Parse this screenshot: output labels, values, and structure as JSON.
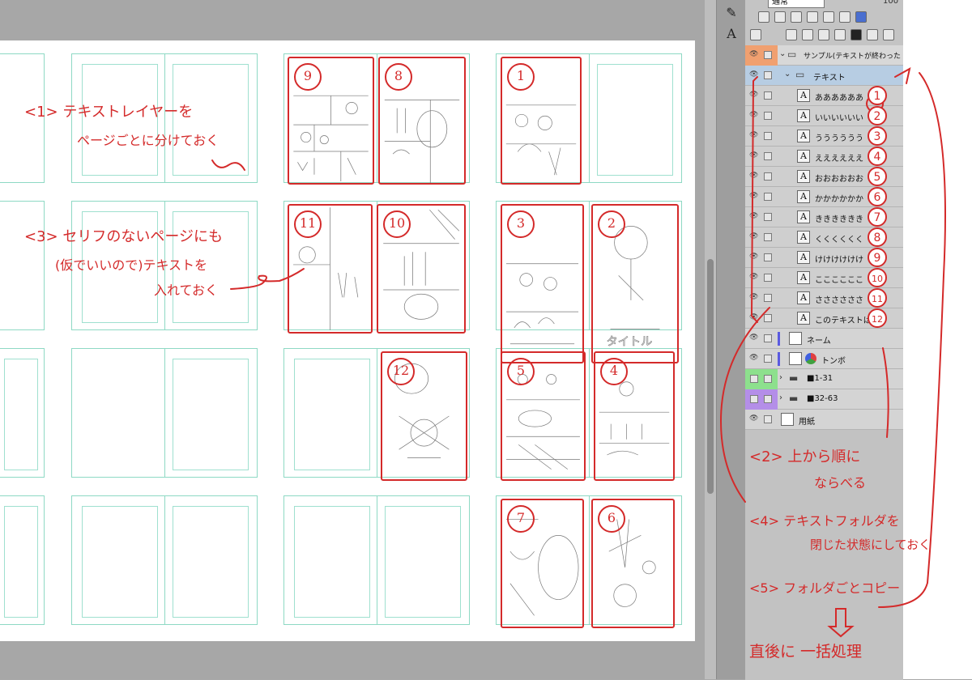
{
  "layer_panel": {
    "blend_mode": "通常",
    "opacity": "100",
    "layers": [
      {
        "name": "サンプル(テキストが終わったら消し",
        "kind": "folder",
        "color": "#f0a070"
      },
      {
        "name": "テキスト",
        "kind": "folder",
        "selected": true
      },
      {
        "name": "ああああああ",
        "kind": "text",
        "marker": "1"
      },
      {
        "name": "いいいいいい",
        "kind": "text",
        "marker": "2"
      },
      {
        "name": "うううううう",
        "kind": "text",
        "marker": "3"
      },
      {
        "name": "ええええええ",
        "kind": "text",
        "marker": "4"
      },
      {
        "name": "おおおおおお",
        "kind": "text",
        "marker": "5"
      },
      {
        "name": "かかかかかか",
        "kind": "text",
        "marker": "6"
      },
      {
        "name": "きききききき",
        "kind": "text",
        "marker": "7"
      },
      {
        "name": "くくくくくく",
        "kind": "text",
        "marker": "8"
      },
      {
        "name": "けけけけけけ",
        "kind": "text",
        "marker": "9"
      },
      {
        "name": "ここここここ",
        "kind": "text",
        "marker": "10"
      },
      {
        "name": "ささささささ",
        "kind": "text",
        "marker": "11"
      },
      {
        "name": "このテキストは デ",
        "kind": "text",
        "marker": "12"
      },
      {
        "name": "ネーム",
        "kind": "layer"
      },
      {
        "name": "トンボ",
        "kind": "layer"
      },
      {
        "name": "■1-31",
        "kind": "folder",
        "color": "#8de08d"
      },
      {
        "name": "■32-63",
        "kind": "folder",
        "color": "#b48ee8"
      },
      {
        "name": "用紙",
        "kind": "paper"
      }
    ]
  },
  "canvas": {
    "page_numbers": [
      "9",
      "8",
      "1",
      "11",
      "10",
      "3",
      "2",
      "12",
      "5",
      "4",
      "7",
      "6"
    ]
  },
  "notes": {
    "n1_a": "<1> テキストレイヤーを",
    "n1_b": "ページごとに分けておく",
    "n3_a": "<3> セリフのないページにも",
    "n3_b": "(仮でいいので)テキストを",
    "n3_c": "入れておく",
    "n2_a": "<2> 上から順に",
    "n2_b": "ならべる",
    "n4_a": "<4> テキストフォルダを",
    "n4_b": "閉じた状態にしておく",
    "n5": "<5> フォルダごとコピー",
    "n6": "直後に 一括処理"
  },
  "colors": {
    "annotation": "#d42a2a",
    "guide": "#8ed9c4",
    "selected_layer": "#9fc2e0"
  }
}
